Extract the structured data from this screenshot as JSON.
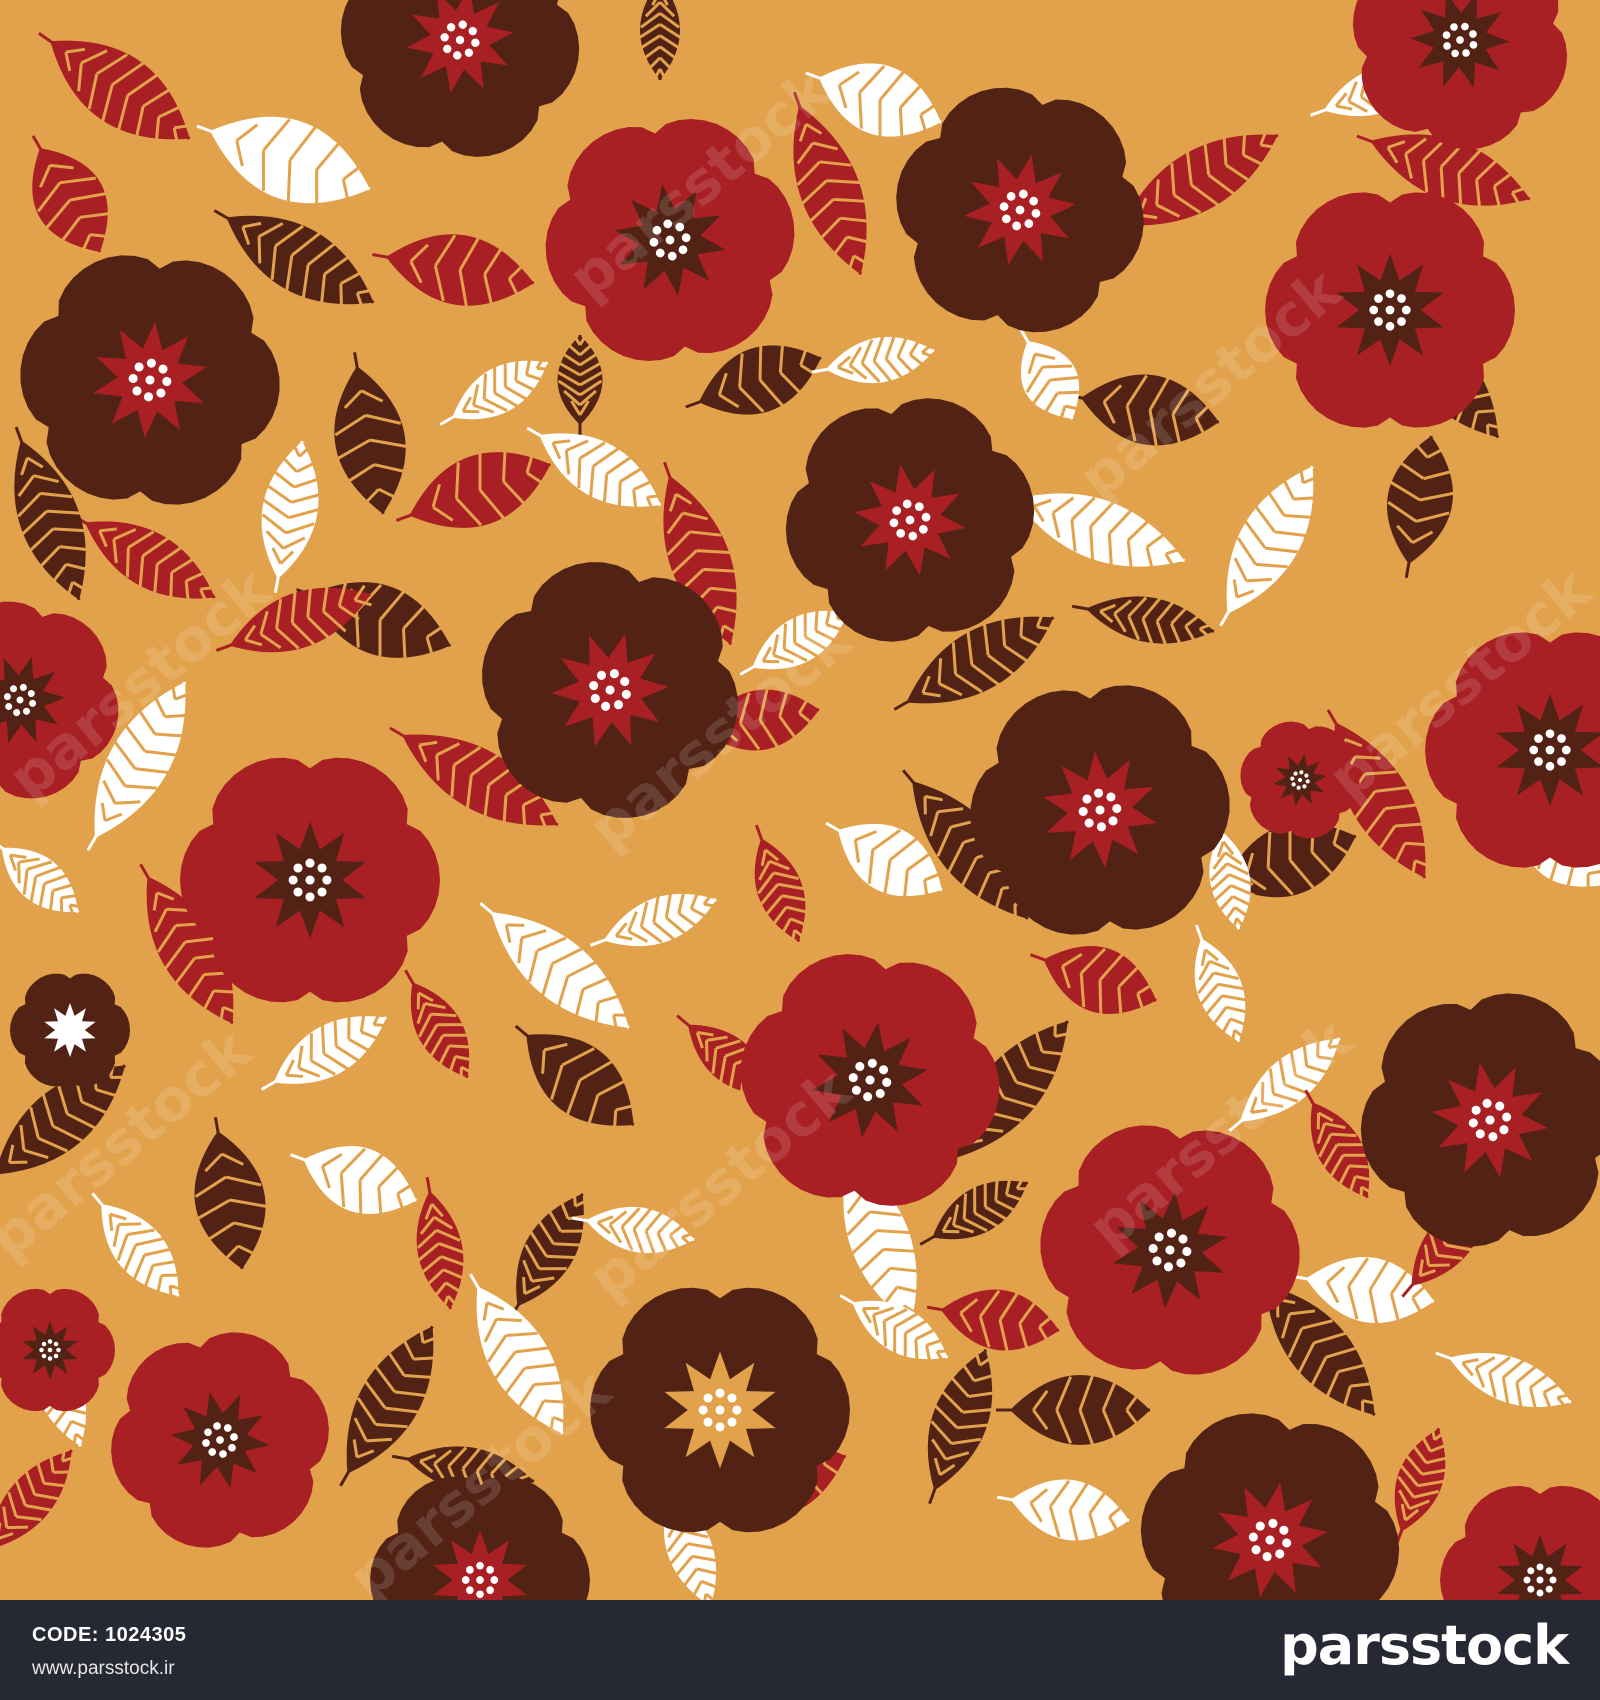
{
  "pattern": {
    "background_color": "#e2a24c",
    "colors": {
      "red": "#a81f24",
      "dark_brown": "#522315",
      "white": "#ffffff",
      "orange": "#e2a24c"
    },
    "motifs": [
      "flower-icon",
      "leaf-icon",
      "feather-leaf-icon"
    ]
  },
  "watermark": {
    "text": "parsstock"
  },
  "footer": {
    "code_label": "CODE:",
    "code_value": "1024305",
    "site_url": "www.parsstock.ir",
    "brand_name": "parsstock",
    "background_color": "#262833"
  }
}
